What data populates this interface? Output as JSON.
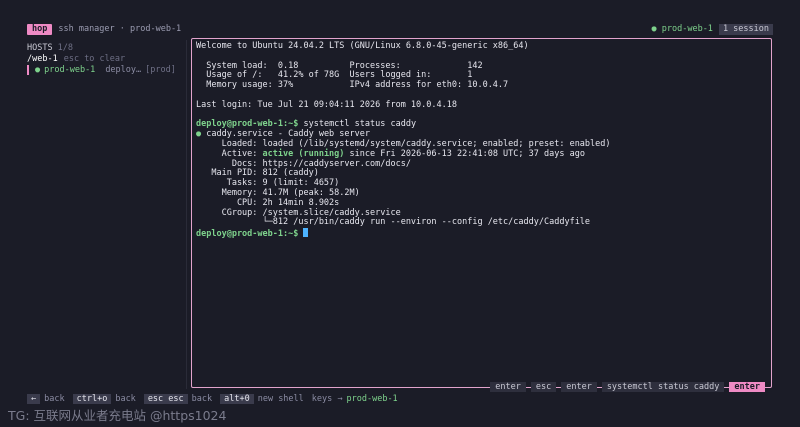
{
  "header": {
    "app_badge": "hop",
    "title": "ssh manager · prod-web-1",
    "active_host": "● prod-web-1",
    "session_count": "1 session"
  },
  "sidebar": {
    "heading": "HOSTS",
    "count": "1/8",
    "filter_value": "/web-1",
    "filter_hint": "esc to clear",
    "hosts": [
      {
        "dot": "●",
        "name": "prod-web-1",
        "user": "deploy…",
        "tag": "[prod]"
      }
    ]
  },
  "terminal": {
    "welcome": "Welcome to Ubuntu 24.04.2 LTS (GNU/Linux 6.8.0-45-generic x86_64)",
    "stats": [
      "  System load:  0.18          Processes:             142",
      "  Usage of /:   41.2% of 78G  Users logged in:       1",
      "  Memory usage: 37%           IPv4 address for eth0: 10.0.4.7"
    ],
    "last_login": "Last login: Tue Jul 21 09:04:11 2026 from 10.0.4.18",
    "prompt": "deploy@prod-web-1:~$",
    "command": " systemctl status caddy",
    "service_dot": "●",
    "service_line": " caddy.service - Caddy web server",
    "loaded": "     Loaded: loaded (/lib/systemd/system/caddy.service; enabled; preset: enabled)",
    "active_label": "     Active: ",
    "active_state": "active (running)",
    "active_rest": " since Fri 2026-06-13 22:41:08 UTC; 37 days ago",
    "details": [
      "       Docs: https://caddyserver.com/docs/",
      "   Main PID: 812 (caddy)",
      "      Tasks: 9 (limit: 4657)",
      "     Memory: 41.7M (peak: 58.2M)",
      "        CPU: 2h 14min 8.902s",
      "     CGroup: /system.slice/caddy.service",
      "             └─812 /usr/bin/caddy run --environ --config /etc/caddy/Caddyfile"
    ],
    "final_prompt": "deploy@prod-web-1:~$",
    "key_history": [
      "enter",
      "esc",
      "enter",
      "systemctl status caddy",
      "enter"
    ]
  },
  "footer": {
    "hints": [
      {
        "key": "←",
        "label": "back"
      },
      {
        "key": "ctrl+o",
        "label": "back"
      },
      {
        "key": "esc esc",
        "label": "back"
      },
      {
        "key": "alt+0",
        "label": "new shell"
      }
    ],
    "keys_label": "keys →",
    "keys_target": "prod-web-1"
  },
  "watermark": "TG: 互联网从业者充电站 @https1024"
}
